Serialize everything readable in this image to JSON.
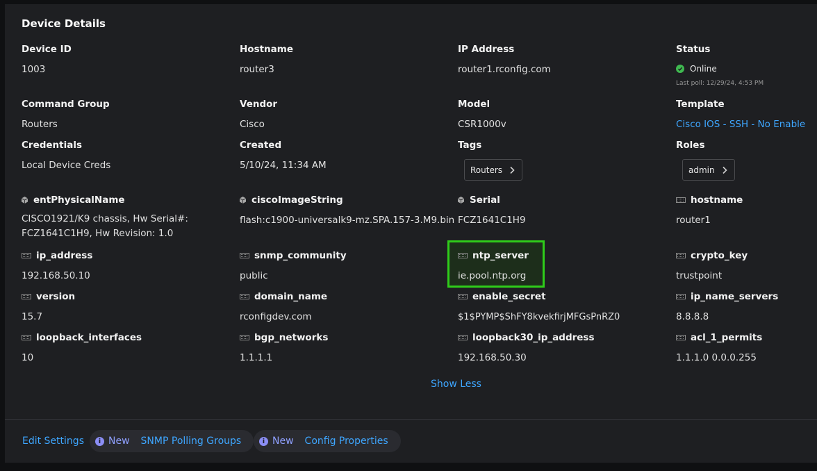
{
  "title": "Device Details",
  "basic": {
    "device_id": {
      "label": "Device ID",
      "value": "1003"
    },
    "hostname": {
      "label": "Hostname",
      "value": "router3"
    },
    "ip_address": {
      "label": "IP Address",
      "value": "router1.rconfig.com"
    },
    "status": {
      "label": "Status",
      "value": "Online",
      "last_poll": "Last poll: 12/29/24, 4:53 PM",
      "color": "#3fb950"
    },
    "command_group": {
      "label": "Command Group",
      "value": "Routers"
    },
    "vendor": {
      "label": "Vendor",
      "value": "Cisco"
    },
    "model": {
      "label": "Model",
      "value": "CSR1000v"
    },
    "template": {
      "label": "Template",
      "value": "Cisco IOS - SSH - No Enable"
    },
    "credentials": {
      "label": "Credentials",
      "value": "Local Device Creds"
    },
    "created": {
      "label": "Created",
      "value": "5/10/24, 11:34 AM"
    },
    "tags": {
      "label": "Tags",
      "chip": "Routers"
    },
    "roles": {
      "label": "Roles",
      "chip": "admin"
    }
  },
  "props": {
    "entPhysicalName": {
      "label": "entPhysicalName",
      "value": "CISCO1921/K9 chassis, Hw Serial#: FCZ1641C1H9, Hw Revision: 1.0",
      "icon": "cube-icon"
    },
    "ciscoImageString": {
      "label": "ciscoImageString",
      "value": "flash:c1900-universalk9-mz.SPA.157-3.M9.bin",
      "icon": "cube-icon"
    },
    "serial": {
      "label": "Serial",
      "value": "FCZ1641C1H9",
      "icon": "cube-icon"
    },
    "hostname": {
      "label": "hostname",
      "value": "router1",
      "icon": "variable-icon"
    },
    "ip_address": {
      "label": "ip_address",
      "value": "192.168.50.10",
      "icon": "variable-icon"
    },
    "snmp_community": {
      "label": "snmp_community",
      "value": "public",
      "icon": "variable-icon"
    },
    "ntp_server": {
      "label": "ntp_server",
      "value": "ie.pool.ntp.org",
      "icon": "variable-icon"
    },
    "crypto_key": {
      "label": "crypto_key",
      "value": "trustpoint",
      "icon": "variable-icon"
    },
    "version": {
      "label": "version",
      "value": "15.7",
      "icon": "variable-icon"
    },
    "domain_name": {
      "label": "domain_name",
      "value": "rconfigdev.com",
      "icon": "variable-icon"
    },
    "enable_secret": {
      "label": "enable_secret",
      "value": "$1$PYMP$ShFY8kvekfirjMFGsPnRZ0",
      "icon": "variable-icon"
    },
    "ip_name_servers": {
      "label": "ip_name_servers",
      "value": "8.8.8.8",
      "icon": "variable-icon"
    },
    "loopback_interfaces": {
      "label": "loopback_interfaces",
      "value": "10",
      "icon": "variable-icon"
    },
    "bgp_networks": {
      "label": "bgp_networks",
      "value": "1.1.1.1",
      "icon": "variable-icon"
    },
    "loopback30_ip_address": {
      "label": "loopback30_ip_address",
      "value": "192.168.50.30",
      "icon": "variable-icon"
    },
    "acl_1_permits": {
      "label": "acl_1_permits",
      "value": "1.1.1.0 0.0.0.255",
      "icon": "variable-icon"
    }
  },
  "show_less": "Show Less",
  "footer": {
    "edit_settings": "Edit Settings",
    "snmp": {
      "badge": "New",
      "label": "SNMP Polling Groups"
    },
    "config": {
      "badge": "New",
      "label": "Config Properties"
    }
  },
  "colors": {
    "link": "#3ea6ff",
    "highlight": "#2fcc1a",
    "online": "#3fb950"
  }
}
